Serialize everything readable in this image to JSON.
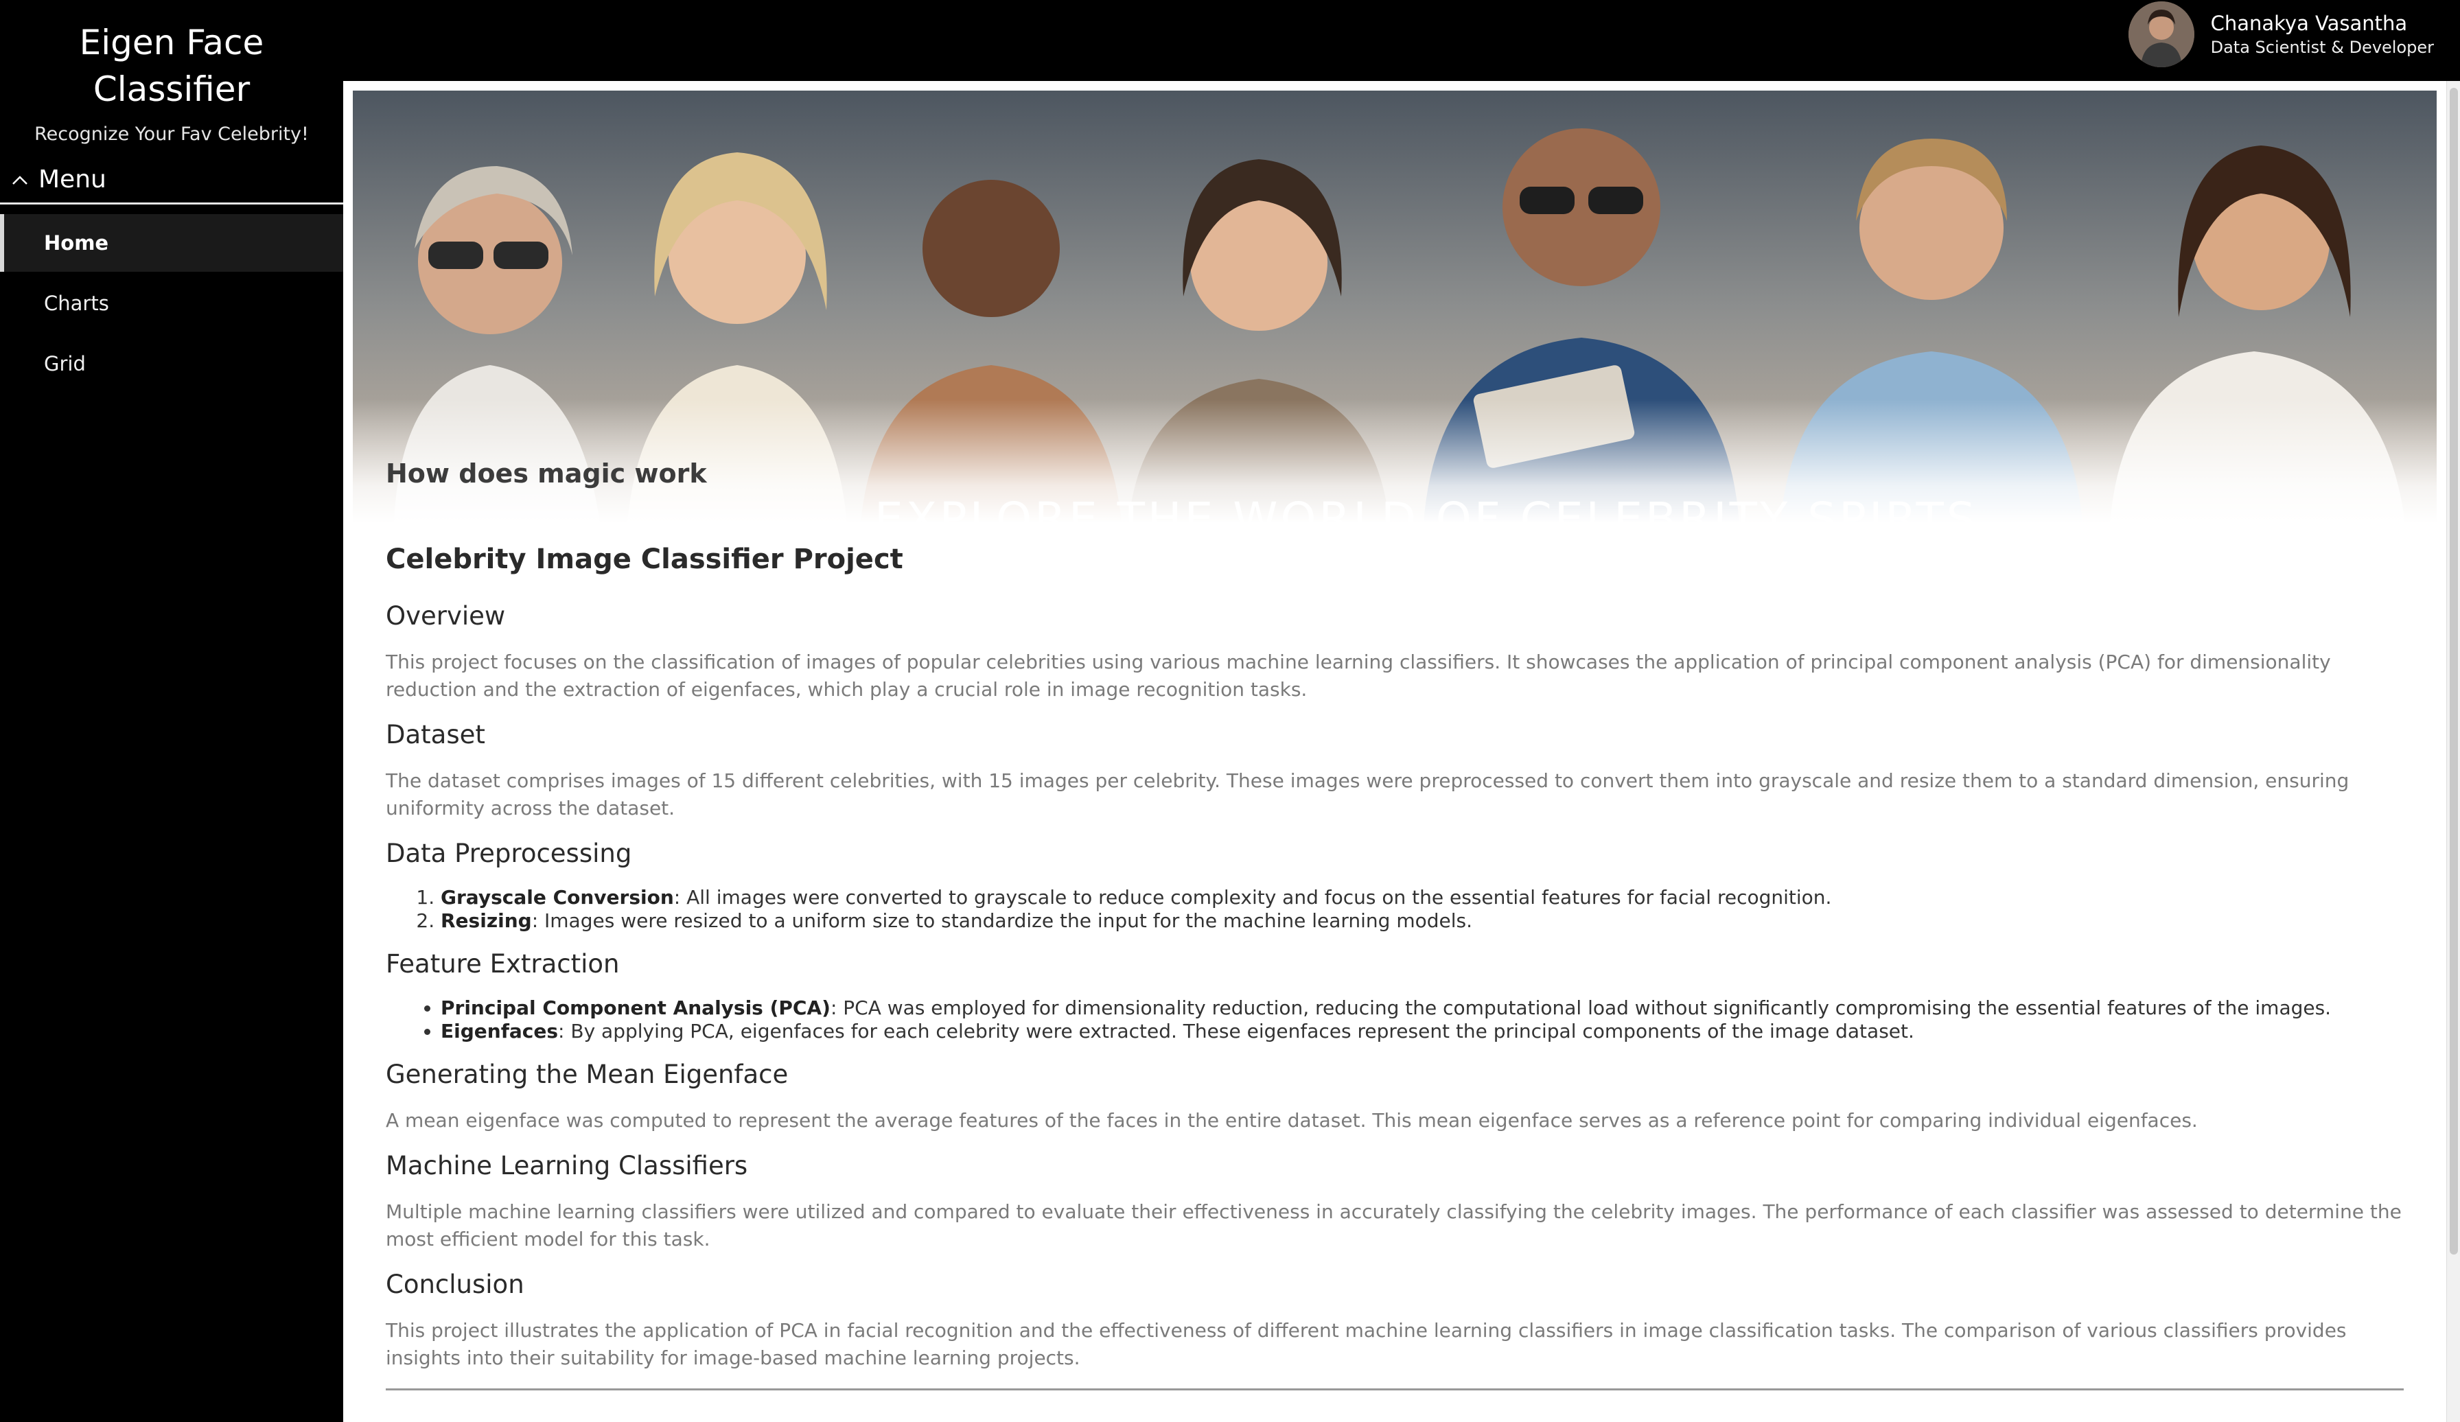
{
  "sidebar": {
    "title_line1": "Eigen Face",
    "title_line2": "Classifier",
    "subtitle": "Recognize Your Fav Celebrity!",
    "menu_label": "Menu",
    "items": [
      {
        "label": "Home",
        "active": true
      },
      {
        "label": "Charts",
        "active": false
      },
      {
        "label": "Grid",
        "active": false
      }
    ]
  },
  "user": {
    "name": "Chanakya Vasantha",
    "role": "Data Scientist & Developer"
  },
  "banner": {
    "heading": "How does magic work",
    "tagline": "EXPLORE THE WORLD OF CELEBRITY SPIRTS"
  },
  "article": {
    "title": "Celebrity Image Classifier Project",
    "overview": {
      "heading": "Overview",
      "text": "This project focuses on the classification of images of popular celebrities using various machine learning classifiers. It showcases the application of principal component analysis (PCA) for dimensionality reduction and the extraction of eigenfaces, which play a crucial role in image recognition tasks."
    },
    "dataset": {
      "heading": "Dataset",
      "text": "The dataset comprises images of 15 different celebrities, with 15 images per celebrity. These images were preprocessed to convert them into grayscale and resize them to a standard dimension, ensuring uniformity across the dataset."
    },
    "preprocessing": {
      "heading": "Data Preprocessing",
      "items": [
        {
          "term": "Grayscale Conversion",
          "text": ": All images were converted to grayscale to reduce complexity and focus on the essential features for facial recognition."
        },
        {
          "term": "Resizing",
          "text": ": Images were resized to a uniform size to standardize the input for the machine learning models."
        }
      ]
    },
    "features": {
      "heading": "Feature Extraction",
      "items": [
        {
          "term": "Principal Component Analysis (PCA)",
          "text": ": PCA was employed for dimensionality reduction, reducing the computational load without significantly compromising the essential features of the images."
        },
        {
          "term": "Eigenfaces",
          "text": ": By applying PCA, eigenfaces for each celebrity were extracted. These eigenfaces represent the principal components of the image dataset."
        }
      ]
    },
    "mean": {
      "heading": "Generating the Mean Eigenface",
      "text": "A mean eigenface was computed to represent the average features of the faces in the entire dataset. This mean eigenface serves as a reference point for comparing individual eigenfaces."
    },
    "classifiers": {
      "heading": "Machine Learning Classifiers",
      "text": "Multiple machine learning classifiers were utilized and compared to evaluate their effectiveness in accurately classifying the celebrity images. The performance of each classifier was assessed to determine the most efficient model for this task."
    },
    "conclusion": {
      "heading": "Conclusion",
      "text": "This project illustrates the application of PCA in facial recognition and the effectiveness of different machine learning classifiers in image classification tasks. The comparison of various classifiers provides insights into their suitability for image-based machine learning projects."
    }
  },
  "icons": {
    "menu_toggle": "chevron-up-icon"
  }
}
